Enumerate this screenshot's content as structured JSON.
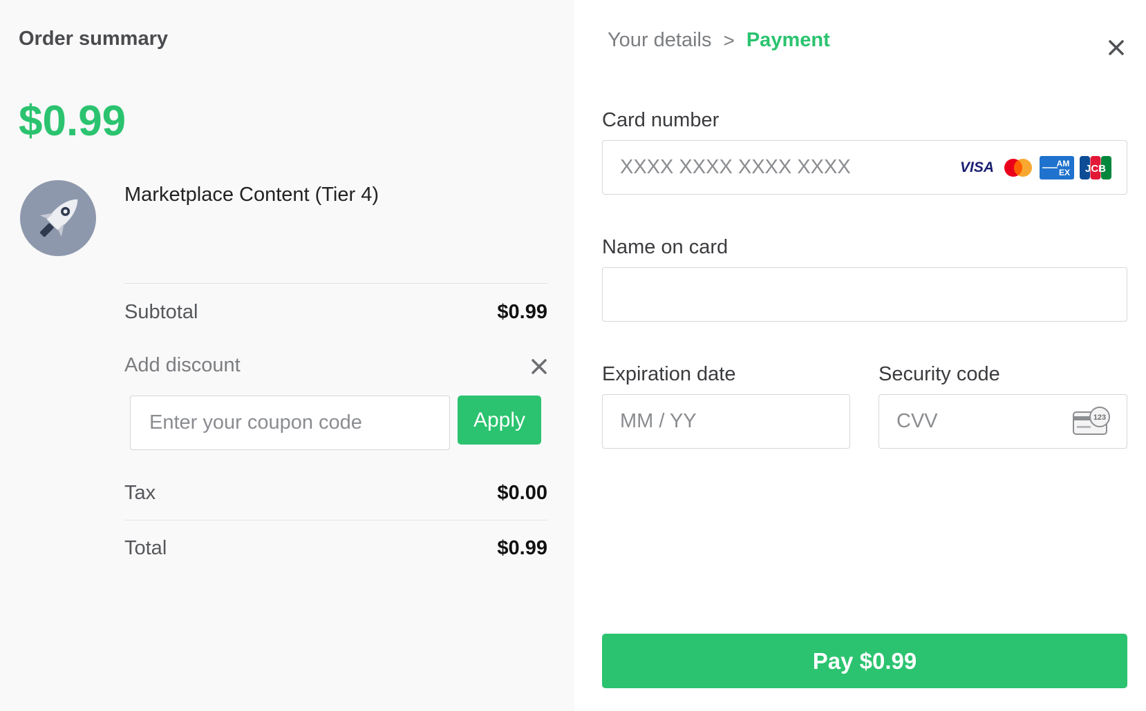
{
  "order": {
    "title": "Order summary",
    "price": "$0.99",
    "product_name": "Marketplace Content (Tier 4)",
    "product_icon": "rocket-icon",
    "subtotal_label": "Subtotal",
    "subtotal_value": "$0.99",
    "discount_label": "Add discount",
    "coupon_placeholder": "Enter your coupon code",
    "apply_label": "Apply",
    "tax_label": "Tax",
    "tax_value": "$0.00",
    "total_label": "Total",
    "total_value": "$0.99"
  },
  "breadcrumb": {
    "step1": "Your details",
    "separator": ">",
    "step2": "Payment"
  },
  "payment": {
    "card_number_label": "Card number",
    "card_number_placeholder": "XXXX XXXX XXXX XXXX",
    "card_brands": [
      "visa",
      "mastercard",
      "amex",
      "jcb"
    ],
    "visa_text": "VISA",
    "name_label": "Name on card",
    "name_value": "",
    "expiration_label": "Expiration date",
    "expiration_placeholder": "MM / YY",
    "security_label": "Security code",
    "security_placeholder": "CVV",
    "cvv_icon_text": "123",
    "pay_label": "Pay $0.99"
  },
  "colors": {
    "accent": "#2bc36f",
    "left_background": "#f9f9f9",
    "avatar": "#8e98ad"
  }
}
